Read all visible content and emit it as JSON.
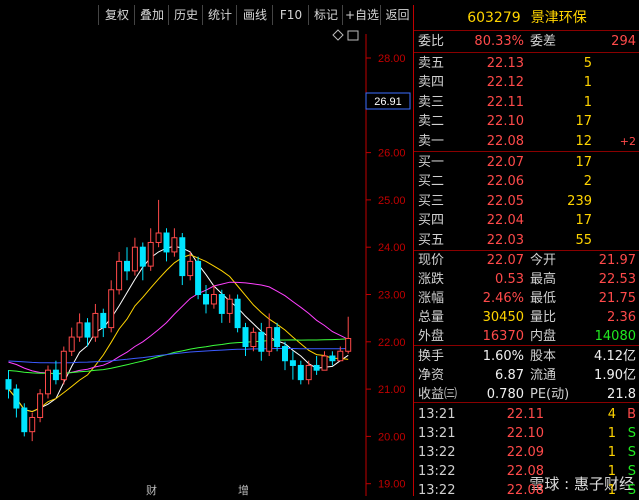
{
  "toolbar": {
    "items": [
      "复权",
      "叠加",
      "历史",
      "统计",
      "画线",
      "F10",
      "标记",
      "+自选",
      "返回"
    ]
  },
  "stock": {
    "code": "603279",
    "name": "景津环保"
  },
  "chart": {
    "price_axis": [
      "28.00",
      "27.00",
      "26.00",
      "25.00",
      "24.00",
      "23.00",
      "22.00",
      "21.00",
      "20.00",
      "19.00"
    ],
    "crosshair_price": "26.91",
    "bottom_marks": [
      "财",
      "增"
    ],
    "corner_icons": [
      "diamond-icon",
      "window-icon"
    ]
  },
  "weibi": {
    "label1": "委比",
    "value1": "80.33%",
    "label2": "委差",
    "value2": "294"
  },
  "sells": [
    {
      "label": "卖五",
      "price": "22.13",
      "vol": "5",
      "chg": ""
    },
    {
      "label": "卖四",
      "price": "22.12",
      "vol": "1",
      "chg": ""
    },
    {
      "label": "卖三",
      "price": "22.11",
      "vol": "1",
      "chg": ""
    },
    {
      "label": "卖二",
      "price": "22.10",
      "vol": "17",
      "chg": ""
    },
    {
      "label": "卖一",
      "price": "22.08",
      "vol": "12",
      "chg": "+2"
    }
  ],
  "buys": [
    {
      "label": "买一",
      "price": "22.07",
      "vol": "17"
    },
    {
      "label": "买二",
      "price": "22.06",
      "vol": "2"
    },
    {
      "label": "买三",
      "price": "22.05",
      "vol": "239"
    },
    {
      "label": "买四",
      "price": "22.04",
      "vol": "17"
    },
    {
      "label": "买五",
      "price": "22.03",
      "vol": "55"
    }
  ],
  "quote": [
    {
      "l1": "现价",
      "v1": "22.07",
      "c1": "red",
      "l2": "今开",
      "v2": "21.97",
      "c2": "red"
    },
    {
      "l1": "涨跌",
      "v1": "0.53",
      "c1": "red",
      "l2": "最高",
      "v2": "22.53",
      "c2": "red"
    },
    {
      "l1": "涨幅",
      "v1": "2.46%",
      "c1": "red",
      "l2": "最低",
      "v2": "21.75",
      "c2": "red"
    },
    {
      "l1": "总量",
      "v1": "30450",
      "c1": "yellow",
      "l2": "量比",
      "v2": "2.36",
      "c2": "red"
    },
    {
      "l1": "外盘",
      "v1": "16370",
      "c1": "red",
      "l2": "内盘",
      "v2": "14080",
      "c2": "green"
    }
  ],
  "fund": [
    {
      "l1": "换手",
      "v1": "1.60%",
      "l2": "股本",
      "v2": "4.12亿"
    },
    {
      "l1": "净资",
      "v1": "6.87",
      "l2": "流通",
      "v2": "1.90亿"
    },
    {
      "l1": "收益㈢",
      "v1": "0.780",
      "l2": "PE(动)",
      "v2": "21.8"
    }
  ],
  "ticks": [
    {
      "time": "13:21",
      "price": "22.11",
      "vol": "4",
      "side": "B",
      "color": "red"
    },
    {
      "time": "13:21",
      "price": "22.10",
      "vol": "1",
      "side": "S",
      "color": "green"
    },
    {
      "time": "13:22",
      "price": "22.09",
      "vol": "1",
      "side": "S",
      "color": "green"
    },
    {
      "time": "13:22",
      "price": "22.08",
      "vol": "1",
      "side": "S",
      "color": "green"
    },
    {
      "time": "13:22",
      "price": "22.08",
      "vol": "1",
      "side": "S",
      "color": "green"
    }
  ],
  "watermark": "雪球 : 惠子财经",
  "colors": {
    "up": "#ff4a4a",
    "down": "#00e5ff",
    "ma5": "#ffffff",
    "ma10": "#ffd400",
    "ma20": "#ff40ff",
    "ma60": "#3cff3c",
    "ma120": "#3b5bff",
    "accent": "#c00000"
  }
}
